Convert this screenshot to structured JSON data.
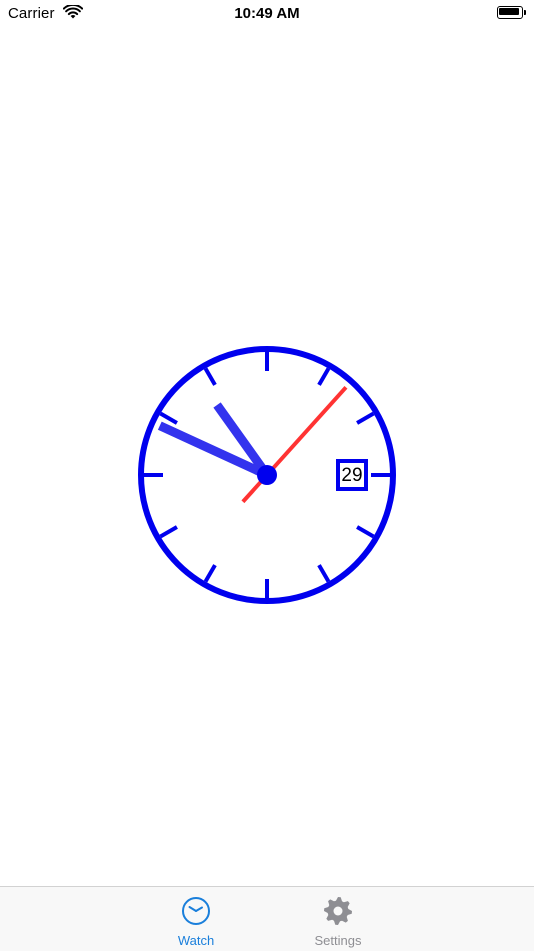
{
  "status_bar": {
    "carrier": "Carrier",
    "time": "10:49 AM"
  },
  "clock": {
    "date": "29",
    "hour": 10,
    "minute": 49,
    "second": 7,
    "face_color": "#0000ee",
    "hand_color": "#3333ee",
    "second_hand_color": "#ff3333"
  },
  "tab_bar": {
    "tabs": [
      {
        "label": "Watch",
        "icon": "clock-icon",
        "selected": true,
        "color": "#1a7fdb"
      },
      {
        "label": "Settings",
        "icon": "gear-icon",
        "selected": false,
        "color": "#8e8e93"
      }
    ]
  }
}
